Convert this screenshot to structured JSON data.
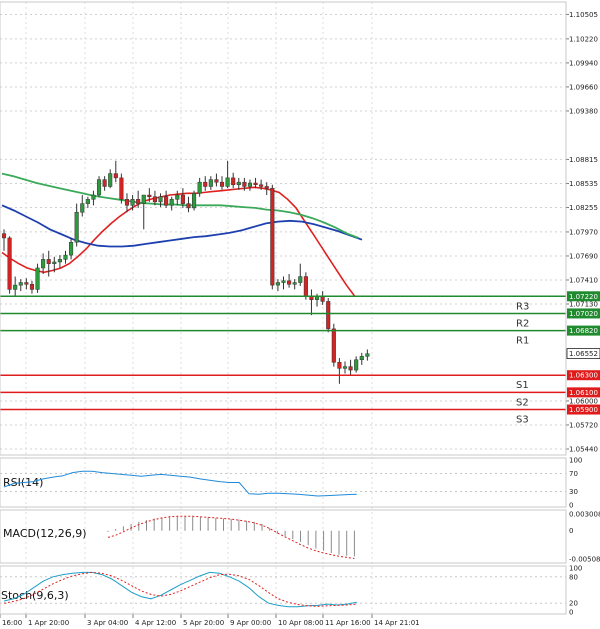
{
  "chart_data": {
    "type": "candlestick",
    "price_axis": {
      "labels": [
        "1.10505",
        "1.10220",
        "1.09940",
        "1.09660",
        "1.09380",
        "1.08815",
        "1.08535",
        "1.08255",
        "1.07970",
        "1.07690",
        "1.07410",
        "1.07130",
        "1.06000",
        "1.05720",
        "1.05440"
      ],
      "range": [
        1.0537,
        1.1065
      ]
    },
    "time_axis": {
      "labels": [
        "16:00",
        "1 Apr 20:00",
        "3 Apr 04:00",
        "4 Apr 12:00",
        "5 Apr 20:00",
        "9 Apr 00:00",
        "10 Apr 08:00",
        "11 Apr 16:00",
        "14 Apr 21:01"
      ]
    },
    "current_price": "1.06552",
    "levels": [
      {
        "name": "R3",
        "value": 1.0722,
        "label": "1.07220",
        "kind": "resistance"
      },
      {
        "name": "R2",
        "value": 1.0702,
        "label": "1.07020",
        "kind": "resistance"
      },
      {
        "name": "R1",
        "value": 1.0682,
        "label": "1.06820",
        "kind": "resistance"
      },
      {
        "name": "S1",
        "value": 1.063,
        "label": "1.06300",
        "kind": "support"
      },
      {
        "name": "S2",
        "value": 1.061,
        "label": "1.06100",
        "kind": "support"
      },
      {
        "name": "S3",
        "value": 1.059,
        "label": "1.05900",
        "kind": "support"
      }
    ],
    "candles": [
      [
        1.0795,
        1.08,
        1.0775,
        1.079
      ],
      [
        1.079,
        1.0792,
        1.0725,
        1.073
      ],
      [
        1.073,
        1.0745,
        1.0722,
        1.0735
      ],
      [
        1.0735,
        1.0742,
        1.0728,
        1.0738
      ],
      [
        1.0738,
        1.0743,
        1.073,
        1.0736
      ],
      [
        1.0736,
        1.074,
        1.0725,
        1.073
      ],
      [
        1.073,
        1.076,
        1.0726,
        1.0755
      ],
      [
        1.0755,
        1.0772,
        1.0748,
        1.0765
      ],
      [
        1.0765,
        1.0775,
        1.0745,
        1.076
      ],
      [
        1.076,
        1.0768,
        1.075,
        1.0762
      ],
      [
        1.0762,
        1.077,
        1.0755,
        1.0765
      ],
      [
        1.0765,
        1.0775,
        1.076,
        1.077
      ],
      [
        1.077,
        1.079,
        1.0765,
        1.0785
      ],
      [
        1.0785,
        1.083,
        1.078,
        1.082
      ],
      [
        1.082,
        1.084,
        1.0815,
        1.083
      ],
      [
        1.083,
        1.0838,
        1.0825,
        1.0835
      ],
      [
        1.0835,
        1.0845,
        1.0828,
        1.084
      ],
      [
        1.084,
        1.0862,
        1.0838,
        1.0858
      ],
      [
        1.0858,
        1.0862,
        1.0845,
        1.085
      ],
      [
        1.085,
        1.087,
        1.0848,
        1.0865
      ],
      [
        1.0865,
        1.088,
        1.0855,
        1.086
      ],
      [
        1.086,
        1.0865,
        1.083,
        1.0835
      ],
      [
        1.0835,
        1.0842,
        1.082,
        1.0828
      ],
      [
        1.0828,
        1.084,
        1.0822,
        1.0835
      ],
      [
        1.0835,
        1.0845,
        1.0825,
        1.083
      ],
      [
        1.083,
        1.084,
        1.08,
        1.084
      ],
      [
        1.084,
        1.0848,
        1.0832,
        1.0838
      ],
      [
        1.0838,
        1.0845,
        1.0828,
        1.0832
      ],
      [
        1.0832,
        1.0842,
        1.0826,
        1.0838
      ],
      [
        1.0838,
        1.0845,
        1.0825,
        1.0828
      ],
      [
        1.0828,
        1.0838,
        1.0822,
        1.0835
      ],
      [
        1.0835,
        1.0845,
        1.0828,
        1.084
      ],
      [
        1.084,
        1.0848,
        1.0825,
        1.083
      ],
      [
        1.083,
        1.0838,
        1.082,
        1.0825
      ],
      [
        1.0825,
        1.0845,
        1.0822,
        1.0842
      ],
      [
        1.0842,
        1.086,
        1.0838,
        1.0855
      ],
      [
        1.0855,
        1.0862,
        1.0845,
        1.085
      ],
      [
        1.085,
        1.0862,
        1.0846,
        1.0858
      ],
      [
        1.0858,
        1.0865,
        1.085,
        1.0855
      ],
      [
        1.0855,
        1.0862,
        1.0846,
        1.085
      ],
      [
        1.085,
        1.088,
        1.0848,
        1.086
      ],
      [
        1.086,
        1.0866,
        1.0848,
        1.0852
      ],
      [
        1.0852,
        1.086,
        1.0846,
        1.0855
      ],
      [
        1.0855,
        1.086,
        1.0845,
        1.085
      ],
      [
        1.085,
        1.0858,
        1.0845,
        1.0854
      ],
      [
        1.0854,
        1.086,
        1.0848,
        1.0852
      ],
      [
        1.0852,
        1.0858,
        1.0846,
        1.085
      ],
      [
        1.085,
        1.0855,
        1.084,
        1.0848
      ],
      [
        1.0848,
        1.0852,
        1.073,
        1.0735
      ],
      [
        1.0735,
        1.0742,
        1.0728,
        1.0738
      ],
      [
        1.0738,
        1.0745,
        1.073,
        1.074
      ],
      [
        1.074,
        1.0748,
        1.0732,
        1.0736
      ],
      [
        1.0736,
        1.0742,
        1.073,
        1.0738
      ],
      [
        1.0738,
        1.076,
        1.0734,
        1.0745
      ],
      [
        1.0745,
        1.075,
        1.0718,
        1.0722
      ],
      [
        1.0722,
        1.073,
        1.07,
        1.0718
      ],
      [
        1.0718,
        1.0725,
        1.071,
        1.0722
      ],
      [
        1.0722,
        1.0728,
        1.0712,
        1.0716
      ],
      [
        1.0716,
        1.072,
        1.068,
        1.0684
      ],
      [
        1.0684,
        1.069,
        1.064,
        1.0645
      ],
      [
        1.0645,
        1.065,
        1.062,
        1.0638
      ],
      [
        1.0638,
        1.0646,
        1.0632,
        1.064
      ],
      [
        1.064,
        1.0648,
        1.063,
        1.0636
      ],
      [
        1.0636,
        1.0652,
        1.0633,
        1.0648
      ],
      [
        1.0648,
        1.0656,
        1.0642,
        1.0652
      ],
      [
        1.0652,
        1.066,
        1.0647,
        1.0655
      ]
    ],
    "moving_averages": [
      {
        "color": "#e02020",
        "values": [
          1.0773,
          1.0766,
          1.076,
          1.0755,
          1.0752,
          1.075,
          1.0752,
          1.0755,
          1.076,
          1.0768,
          1.0777,
          1.0788,
          1.0798,
          1.0807,
          1.0815,
          1.0822,
          1.0828,
          1.0833,
          1.0836,
          1.0838,
          1.084,
          1.0841,
          1.0842,
          1.0842,
          1.0843,
          1.0844,
          1.0845,
          1.0846,
          1.0847,
          1.0848,
          1.0849,
          1.0848,
          1.0846,
          1.0843,
          1.0835,
          1.0825,
          1.081,
          1.0795,
          1.078,
          1.0765,
          1.075,
          1.0735,
          1.0722
        ]
      },
      {
        "color": "#1e40af",
        "values": [
          1.0828,
          1.0822,
          1.0815,
          1.0808,
          1.08,
          1.0794,
          1.0788,
          1.0784,
          1.0781,
          1.078,
          1.078,
          1.0781,
          1.0783,
          1.0785,
          1.0787,
          1.0789,
          1.0791,
          1.0792,
          1.0794,
          1.0796,
          1.0799,
          1.0803,
          1.0807,
          1.0809,
          1.081,
          1.0809,
          1.0806,
          1.0802,
          1.0798,
          1.0793,
          1.0788
        ]
      },
      {
        "color": "#3aaa5a",
        "values": [
          1.0865,
          1.0862,
          1.0858,
          1.0854,
          1.0851,
          1.0848,
          1.0845,
          1.0842,
          1.0839,
          1.0837,
          1.0835,
          1.0833,
          1.0831,
          1.083,
          1.0829,
          1.0829,
          1.0828,
          1.0828,
          1.0828,
          1.0828,
          1.0827,
          1.0826,
          1.0825,
          1.0823,
          1.0822,
          1.082,
          1.0817,
          1.0813,
          1.0808,
          1.0802,
          1.0795,
          1.079
        ]
      }
    ],
    "rsi": {
      "title": "RSI(14)",
      "ticks": [
        "100",
        "70",
        "30",
        "0"
      ],
      "values": [
        40,
        48,
        50,
        52,
        58,
        62,
        65,
        72,
        75,
        75,
        72,
        70,
        68,
        66,
        64,
        66,
        68,
        66,
        64,
        62,
        58,
        55,
        52,
        50,
        50,
        25,
        24,
        26,
        26,
        25,
        24,
        22,
        20,
        21,
        22,
        23,
        24
      ]
    },
    "macd": {
      "title": "MACD(12,26,9)",
      "ticks": [
        "0.003008",
        "0",
        "-0.005081"
      ],
      "hist": [
        -0.0002,
        0.0003,
        0.0008,
        0.0012,
        0.0016,
        0.0019,
        0.0022,
        0.0024,
        0.0025,
        0.0026,
        0.0026,
        0.0026,
        0.0025,
        0.0024,
        0.0023,
        0.0022,
        0.0021,
        0.002,
        0.0018,
        0.0016,
        0.0012,
        0.0005,
        -0.0005,
        -0.001,
        -0.0015,
        -0.002,
        -0.0026,
        -0.0032,
        -0.0036,
        -0.004,
        -0.0043,
        -0.0045,
        -0.0046
      ],
      "signal": [
        -0.0012,
        -0.0008,
        -0.0002,
        0.0005,
        0.0011,
        0.0016,
        0.002,
        0.0023,
        0.0025,
        0.0026,
        0.0026,
        0.0026,
        0.0025,
        0.0024,
        0.0023,
        0.0022,
        0.0021,
        0.0019,
        0.0017,
        0.0014,
        0.001,
        0.0004,
        -0.0004,
        -0.0011,
        -0.0018,
        -0.0025,
        -0.0031,
        -0.0036,
        -0.004,
        -0.0043,
        -0.0046,
        -0.0048,
        -0.005
      ]
    },
    "stoch": {
      "title": "Stoch(9,6,3)",
      "ticks": [
        "100",
        "80",
        "20",
        "0"
      ],
      "main": [
        25,
        30,
        40,
        55,
        70,
        80,
        85,
        88,
        90,
        90,
        85,
        75,
        60,
        45,
        35,
        30,
        38,
        50,
        62,
        72,
        82,
        90,
        88,
        80,
        70,
        55,
        35,
        20,
        15,
        12,
        12,
        14,
        15,
        18,
        16,
        18,
        22
      ],
      "signal": [
        20,
        24,
        30,
        40,
        52,
        64,
        74,
        82,
        87,
        90,
        88,
        82,
        72,
        60,
        48,
        40,
        36,
        40,
        48,
        58,
        68,
        78,
        85,
        86,
        82,
        74,
        60,
        44,
        30,
        22,
        17,
        14,
        13,
        14,
        15,
        16,
        18
      ]
    }
  }
}
